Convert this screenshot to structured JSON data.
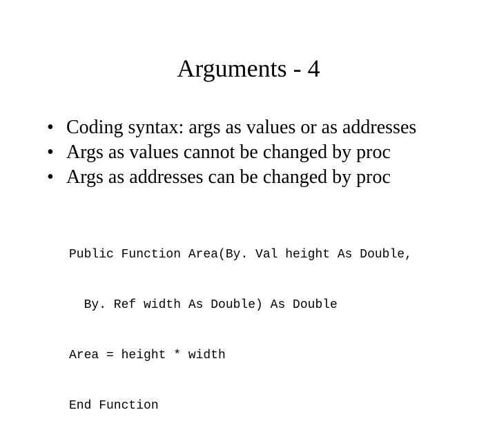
{
  "title": "Arguments - 4",
  "bullets": [
    "Coding syntax: args as values or as addresses",
    "Args as values cannot be changed by proc",
    "Args as addresses can be changed by proc"
  ],
  "code": {
    "line1": "Public Function Area(By. Val height As Double,",
    "line2": "By. Ref width As Double) As Double",
    "line3": "Area = height * width",
    "line4": "End Function"
  }
}
